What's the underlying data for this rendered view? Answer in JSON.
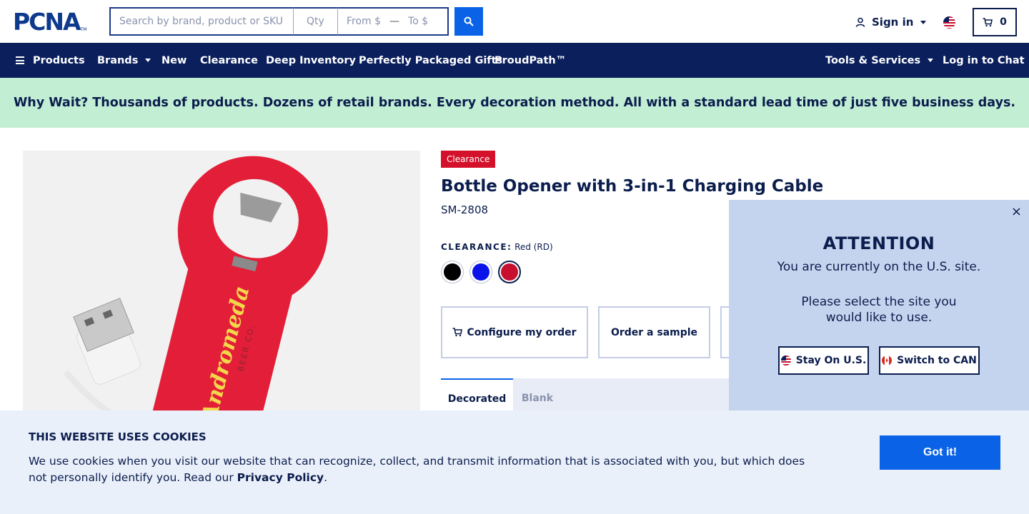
{
  "header": {
    "logo": "PCNA",
    "logo_tm": "TM",
    "search_placeholder": "Search by brand, product or SKU",
    "qty_placeholder": "Qty",
    "price_from": "From $",
    "price_to": "To $",
    "signin_label": "Sign in",
    "cart_count": "0"
  },
  "nav": {
    "items": [
      "Products",
      "Brands",
      "New",
      "Clearance",
      "Deep Inventory",
      "Perfectly Packaged Gifts",
      "ProudPath™"
    ],
    "tools": "Tools & Services",
    "chat": "Log in to Chat"
  },
  "banner": {
    "text": "Why Wait? Thousands of products. Dozens of retail brands. Every decoration method. All with a standard lead time of just five business days."
  },
  "product": {
    "badge": "Clearance",
    "title": "Bottle Opener with 3-in-1 Charging Cable",
    "sku": "SM-2808",
    "color_label": "CLEARANCE:",
    "color_value": "Red (RD)",
    "swatches": [
      "#000000",
      "#0a14e8",
      "#c8102e"
    ],
    "image_imprint": "Andromeda",
    "image_imprint_sub": "BEER CO.",
    "configure_label": "Configure my order",
    "sample_label": "Order a sample",
    "tabs": [
      "Decorated",
      "Blank"
    ]
  },
  "region_modal": {
    "close": "×",
    "title": "ATTENTION",
    "line1": "You are currently on the U.S. site.",
    "line2": "Please select the site you",
    "line3": "would like to use.",
    "stay_label": "Stay On U.S.",
    "switch_label": "Switch to CAN"
  },
  "cookies": {
    "title": "THIS WEBSITE USES COOKIES",
    "text": "We use cookies when you visit our website that can recognize, collect, and transmit information that is associated with you, but which does not personally identify you. Read our ",
    "link": "Privacy Policy",
    "end": ".",
    "button": "Got it!"
  },
  "colors": {
    "navy": "#0a1f5c",
    "accent_blue": "#0a63e6",
    "banner_green": "#c2eed4",
    "clearance_red": "#d4102b"
  }
}
